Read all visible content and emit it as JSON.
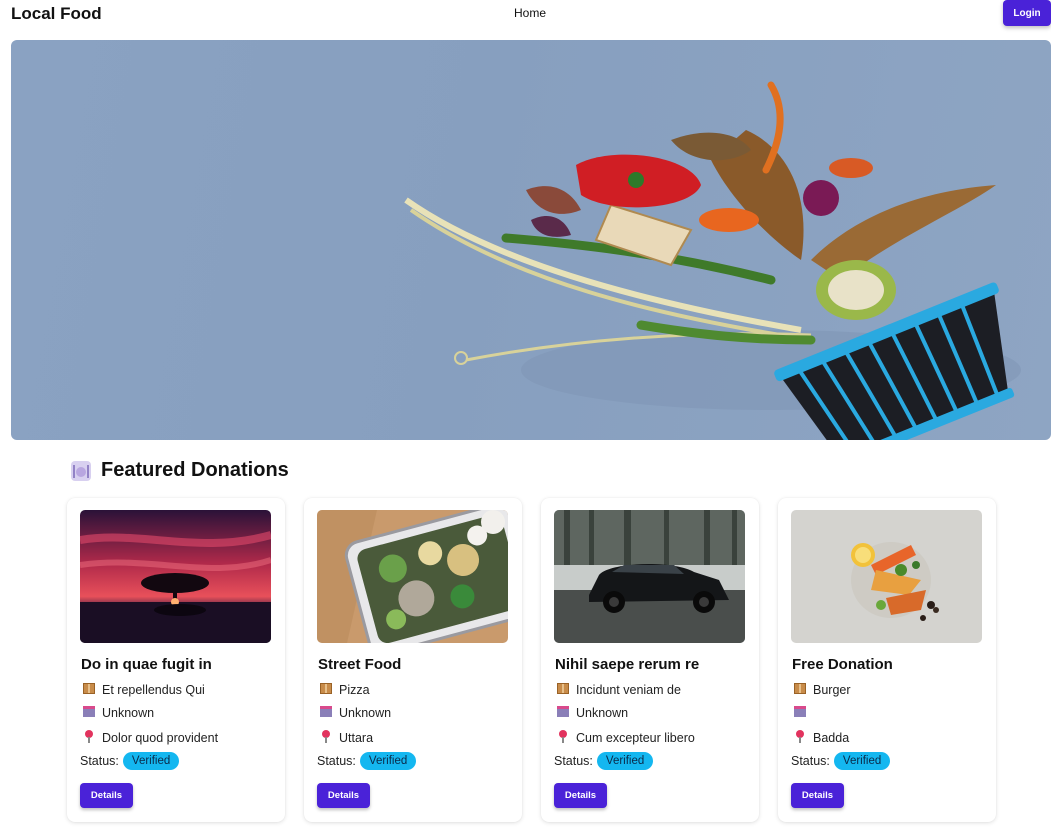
{
  "navbar": {
    "brand": "Local Food",
    "home_label": "Home",
    "login_label": "Login"
  },
  "section": {
    "icon": "dish-icon",
    "title": "Featured Donations"
  },
  "colors": {
    "primary": "#4a22d8",
    "badge": "#14b7f0"
  },
  "cards": [
    {
      "title": "Do in quae fugit in",
      "food": "Et repellendus Qui",
      "donor": "Unknown",
      "location": "Dolor quod provident",
      "status_label": "Status:",
      "status": "Verified",
      "button_label": "Details",
      "image": "sunset-tree-image"
    },
    {
      "title": "Street Food",
      "food": "Pizza",
      "donor": "Unknown",
      "location": "Uttara",
      "status_label": "Status:",
      "status": "Verified",
      "button_label": "Details",
      "image": "food-container-image"
    },
    {
      "title": "Nihil saepe rerum re",
      "food": "Incidunt veniam de",
      "donor": "Unknown",
      "location": "Cum excepteur libero",
      "status_label": "Status:",
      "status": "Verified",
      "button_label": "Details",
      "image": "black-suv-image"
    },
    {
      "title": "Free Donation",
      "food": "Burger",
      "donor": "",
      "location": "Badda",
      "status_label": "Status:",
      "status": "Verified",
      "button_label": "Details",
      "image": "plated-salad-image"
    }
  ]
}
